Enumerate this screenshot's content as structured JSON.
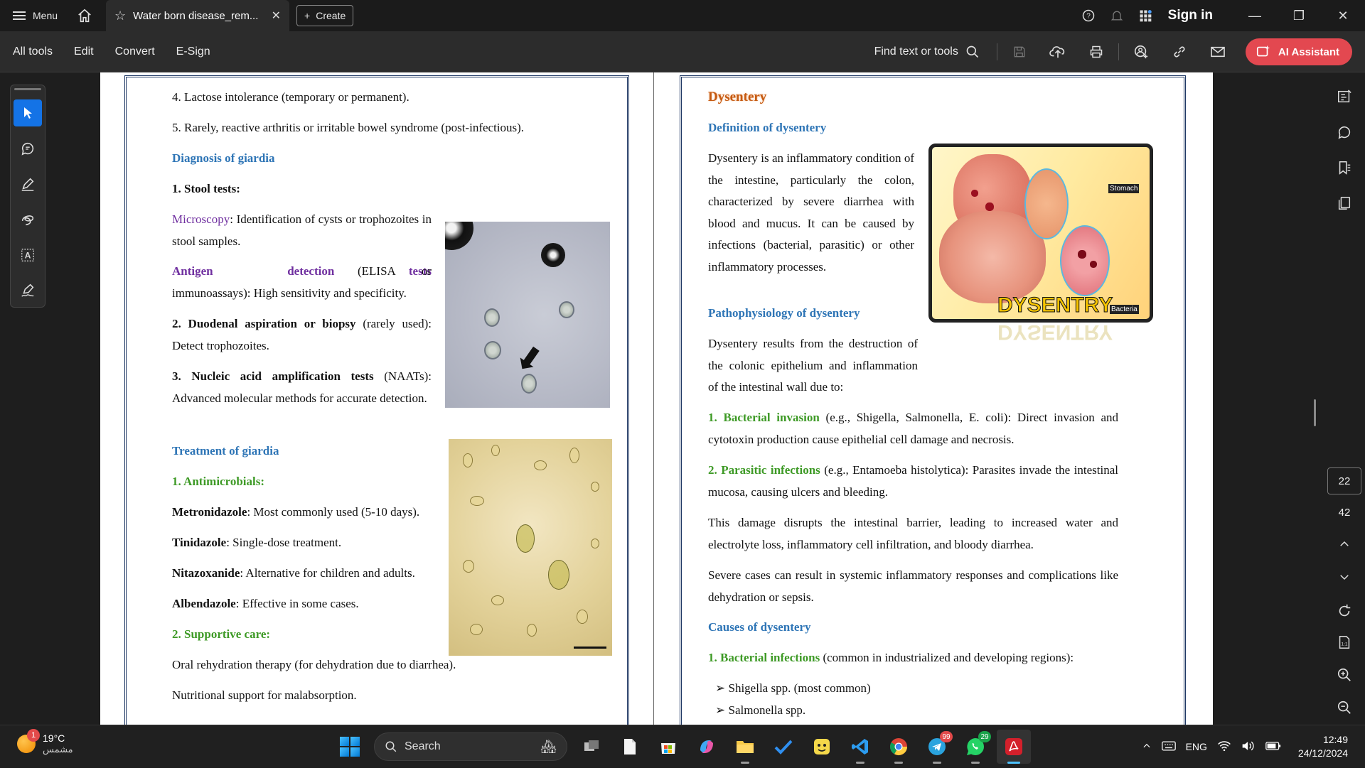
{
  "titlebar": {
    "menu_label": "Menu",
    "tab_title": "Water born disease_rem...",
    "create_label": "Create",
    "sign_in_label": "Sign in"
  },
  "toolbar": {
    "items": [
      "All tools",
      "Edit",
      "Convert",
      "E-Sign"
    ],
    "find_label": "Find text or tools",
    "ai_assistant_label": "AI Assistant"
  },
  "pagination": {
    "current_page": "22",
    "total_pages": "42"
  },
  "page_left": {
    "lines": [
      "4. Lactose intolerance (temporary or permanent).",
      "5. Rarely, reactive arthritis or irritable bowel syndrome (post-infectious)."
    ],
    "diagnosis_heading": "Diagnosis of giardia",
    "stool_heading": "1. Stool tests:",
    "microscopy_label": "Microscopy",
    "microscopy_text": ": Identification of cysts or trophozoites in stool samples.",
    "antigen_label": "Antigen detection tests",
    "antigen_text": "(ELISA or immunoassays): High sensitivity and specificity.",
    "duodenal_label": "2. Duodenal aspiration or biopsy",
    "duodenal_text": "(rarely used): Detect trophozoites.",
    "naat_label": "3. Nucleic acid amplification tests",
    "naat_text": "(NAATs): Advanced molecular methods for accurate detection.",
    "treatment_heading": "Treatment of giardia",
    "antimicrobials_heading": "1. Antimicrobials:",
    "drugs": [
      {
        "name": "Metronidazole",
        "text": ": Most commonly used (5-10 days)."
      },
      {
        "name": "Tinidazole",
        "text": ": Single-dose treatment."
      },
      {
        "name": "Nitazoxanide",
        "text": ": Alternative for children and adults."
      },
      {
        "name": "Albendazole",
        "text": ": Effective in some cases."
      }
    ],
    "supportive_heading": "2. Supportive care:",
    "supportive_lines": [
      "Oral rehydration therapy (for dehydration due to diarrhea).",
      "Nutritional support for malabsorption."
    ]
  },
  "page_right": {
    "title": "Dysentery",
    "definition_heading": "Definition of dysentery",
    "definition_text": "Dysentery is an inflammatory condition of the intestine, particularly the colon, characterized by severe diarrhea with blood and mucus. It can be caused by infections (bacterial, parasitic) or other inflammatory processes.",
    "patho_heading": "Pathophysiology of dysentery",
    "patho_intro": "Dysentery results from the destruction of the colonic epithelium and inflammation of the intestinal wall due to:",
    "bacterial_invasion_label": "1. Bacterial invasion",
    "bacterial_invasion_text": "(e.g., Shigella, Salmonella, E. coli): Direct invasion and cytotoxin production cause epithelial cell damage and necrosis.",
    "parasitic_label": "2. Parasitic infections",
    "parasitic_text": "(e.g., Entamoeba histolytica): Parasites invade the intestinal mucosa, causing ulcers and bleeding.",
    "damage_text": "This damage disrupts the intestinal barrier, leading to increased water and electrolyte loss, inflammatory cell infiltration, and bloody diarrhea.",
    "severe_text": "Severe cases can result in systemic inflammatory responses and complications like dehydration or sepsis.",
    "causes_heading": "Causes of dysentery",
    "bacterial_infections_label": "1. Bacterial infections",
    "bacterial_infections_text": "(common in industrialized and developing regions):",
    "bullets": [
      "Shigella spp. (most common)",
      "Salmonella spp."
    ],
    "image_label": "DYSENTRY",
    "image_tag_stomach": "Stomach",
    "image_tag_bacteria": "Bacteria"
  },
  "taskbar": {
    "weather_temp": "19°C",
    "weather_cond": "مشمس",
    "weather_badge": "1",
    "search_label": "Search",
    "telegram_badge": "99",
    "whatsapp_badge": "29",
    "language": "ENG",
    "time": "12:49",
    "date": "24/12/2024"
  }
}
